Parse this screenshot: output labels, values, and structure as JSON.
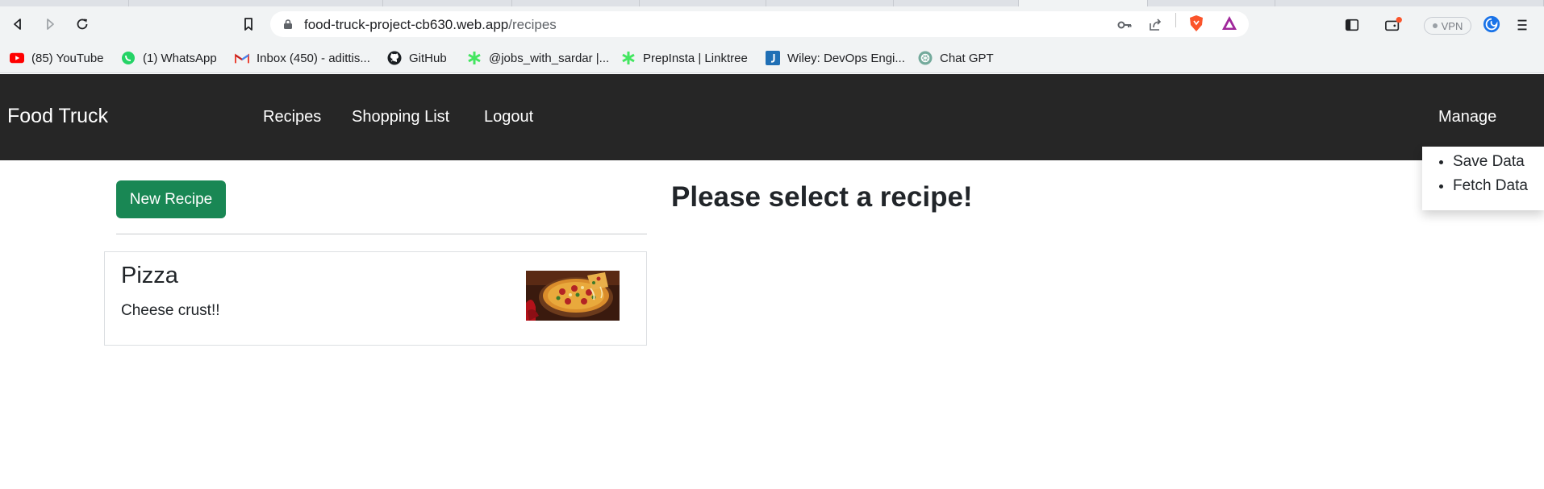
{
  "browser": {
    "url_host": "food-truck-project-cb630.web.app",
    "url_path": "/recipes",
    "vpn_label": "VPN",
    "bookmarks": [
      {
        "label": "(85) YouTube",
        "icon": "youtube-icon"
      },
      {
        "label": "(1) WhatsApp",
        "icon": "whatsapp-icon"
      },
      {
        "label": "Inbox (450) - adittis...",
        "icon": "gmail-icon"
      },
      {
        "label": "GitHub",
        "icon": "github-icon"
      },
      {
        "label": "@jobs_with_sardar |...",
        "icon": "linktree-icon"
      },
      {
        "label": "PrepInsta | Linktree",
        "icon": "linktree-icon"
      },
      {
        "label": "Wiley: DevOps Engi...",
        "icon": "wiley-icon"
      },
      {
        "label": "Chat GPT",
        "icon": "chatgpt-icon"
      }
    ]
  },
  "app": {
    "brand": "Food Truck",
    "nav": [
      "Recipes",
      "Shopping List",
      "Logout"
    ],
    "manage_label": "Manage",
    "manage_menu": [
      "Save Data",
      "Fetch Data"
    ],
    "new_recipe_label": "New Recipe",
    "recipes": [
      {
        "name": "Pizza",
        "description": "Cheese crust!!"
      }
    ],
    "select_prompt": "Please select a recipe!"
  },
  "colors": {
    "navbar": "#262626",
    "success_button": "#198754",
    "chrome_bg": "#f1f3f4"
  }
}
